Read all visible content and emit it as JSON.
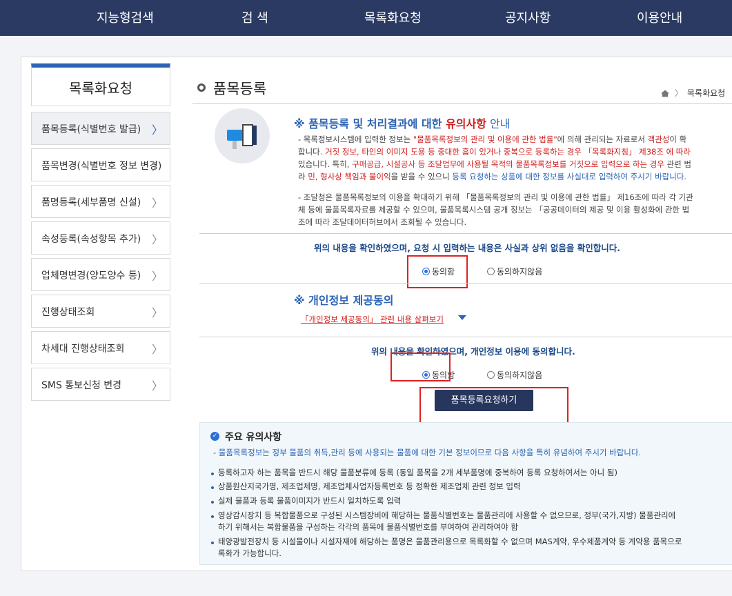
{
  "topnav": {
    "items": [
      "지능형검색",
      "검   색",
      "목록화요청",
      "공지사항",
      "이용안내"
    ]
  },
  "sidebar": {
    "title": "목록화요청",
    "items": [
      {
        "label": "품목등록(식별번호 발급)",
        "active": true
      },
      {
        "label": "품목변경(식별번호 정보 변경)",
        "active": false
      },
      {
        "label": "품명등록(세부품명 신설)",
        "active": false
      },
      {
        "label": "속성등록(속성항목 추가)",
        "active": false
      },
      {
        "label": "업체명변경(양도양수 등)",
        "active": false
      },
      {
        "label": "진행상태조회",
        "active": false
      },
      {
        "label": "차세대 진행상태조회",
        "active": false
      },
      {
        "label": "SMS 통보신청 변경",
        "active": false
      }
    ]
  },
  "page": {
    "title": "품목등록",
    "breadcrumb": "목록화요청"
  },
  "notice": {
    "head_prefix": "※ 품목등록 및 처리결과에 대한 ",
    "head_red": "유의사항",
    "head_suffix": " 안내",
    "line1a": "- 목록정보시스템에 입력한 정보는 ",
    "line1b": "\"물품목록정보의 관리 및 이용에 관한 법률\"",
    "line1c": "에 의해 관리되는 자료",
    "line1d": "로서 ",
    "line1e": "객관성",
    "line1f": "이 확",
    "line2a": "합니다. ",
    "line2b": "거짓 정보, 타인의 이미지 도용 등 중대한 흠이 있거나 중복으로 등록하는 경우 「목록화지침」 제38조 에 따라 ",
    "line3a": "있습니다. 특히, ",
    "line3b": "구매공급, 시설공사 등 조달업무에 사용될 목적의 물품목록정보를 거짓으로 입력으로 하는 경우",
    "line3c": " 관련 법",
    "line4a": "라 ",
    "line4b": "민, 형사상 책임과 불이익",
    "line4c": "을 받을 수 있으니 ",
    "line4d": "등록 요청하는 상품에 대한 정보를 사실대로 입력하여 주시기 바랍니다.",
    "line5": "- 조달청은 물품목록정보의 이용을 확대하기 위해 「물품목록정보의 관리 및 이용에 관한 법률」 제16조에 따라 각 기관",
    "line6": "체 등에 물품목록자료를 제공할 수 있으며, 물품목록시스템 공개 정보는 「공공데이터의 제공 및 이용 활성화에 관한 법",
    "line7": "조에 따라 조달데이터허브에서 조회될 수 있습니다."
  },
  "confirm1": {
    "text": "위의 내용을 확인하였으며, 요청 시 입력하는 내용은 사실과 상위 없음을 확인합니다.",
    "agree": "동의함",
    "disagree": "동의하지않음"
  },
  "privacy": {
    "head": "※ 개인정보 제공동의",
    "link": "「개인정보 제공동의」 관련 내용 살펴보기"
  },
  "confirm2": {
    "text": "위의 내용을 확인하였으며, 개인정보 이용에 동의합니다.",
    "agree": "동의함",
    "disagree": "동의하지않음"
  },
  "submit_label": "품목등록요청하기",
  "notes": {
    "title": "주요 유의사항",
    "sub": "- 물품목록정보는 정부 물품의 취득,관리 등에 사용되는 물품에 대한 기본 정보이므로 다음 사항을 특히 유념하여 주시기 바랍니다.",
    "items": [
      "등록하고자 하는 품목을 반드시 해당 물품분류에 등록 (동일 품목을 2개 세부품명에 중복하여 등록 요청하여서는 아니 됨)",
      "상품원산지국가명, 제조업체명, 제조업체사업자등록번호 등 정확한 제조업체 관련 정보 입력",
      "실제 물품과 등록 물품이미지가 반드시 일치하도록 입력",
      "영상감시장치 등 복합물품으로 구성된 시스템장비에 해당하는 물품식별번호는 물품관리에 사용할 수 없으므로, 정부(국가,지방) 물품관리에",
      "하기 위해서는 복합물품을 구성하는 각각의 품목에 물품식별번호를 부여하여 관리하여야 함",
      "태양광발전장치 등 시설물이나 시설자재에 해당하는 품명은 물품관리용으로 목록화할 수 없으며 MAS계약, 우수제품계약 등 계약용 품목으로",
      "록화가 가능합니다."
    ]
  },
  "colors": {
    "nav_bg": "#2b3a63",
    "accent": "#2d64b5",
    "warning_red": "#d01e1e",
    "highlight_box": "#e02020"
  }
}
